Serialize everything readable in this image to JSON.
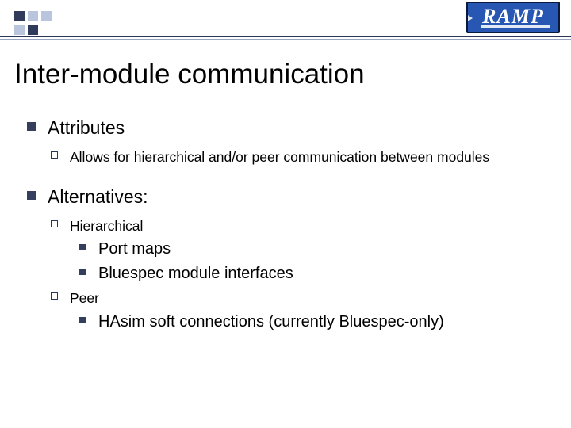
{
  "logo": {
    "text": "RAMP"
  },
  "title": "Inter-module communication",
  "body": {
    "attributes": {
      "heading": "Attributes",
      "items": [
        "Allows for hierarchical and/or peer communication between modules"
      ]
    },
    "alternatives": {
      "heading": "Alternatives:",
      "hierarchical": {
        "label": "Hierarchical",
        "items": [
          "Port maps",
          "Bluespec module interfaces"
        ]
      },
      "peer": {
        "label": "Peer",
        "items": [
          "HAsim soft connections (currently Bluespec-only)"
        ]
      }
    }
  }
}
